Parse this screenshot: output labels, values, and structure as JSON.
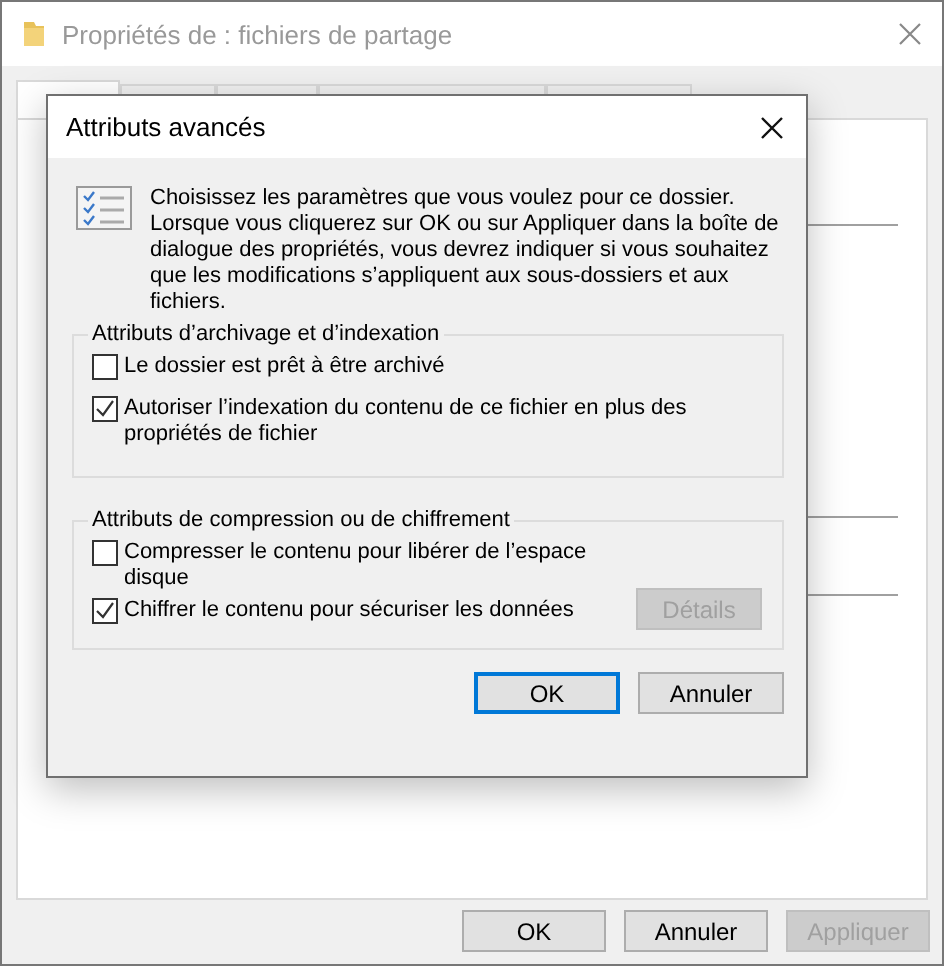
{
  "window": {
    "title": "Propriétés de : fichiers de partage"
  },
  "tabs": [
    {
      "selected": true
    },
    {
      "selected": false
    },
    {
      "selected": false
    },
    {
      "selected": false
    },
    {
      "selected": false
    }
  ],
  "dialog": {
    "title": "Attributs avancés",
    "description": " Choisissez les paramètres que vous voulez pour ce dossier. Lorsque vous cliquerez sur OK ou sur Appliquer dans la boîte de dialogue des propriétés, vous devrez indiquer si vous souhaitez que les modifications s’appliquent aux sous-dossiers et aux fichiers.",
    "groups": [
      {
        "title": "Attributs d’archivage et d’indexation",
        "options": [
          {
            "label": "Le dossier est prêt à être archivé",
            "checked": false
          },
          {
            "label": "Autoriser l’indexation du contenu de ce fichier en plus des propriétés de fichier",
            "checked": true
          }
        ]
      },
      {
        "title": "Attributs de compression ou de chiffrement",
        "options": [
          {
            "label": "Compresser le contenu pour libérer de l’espace disque",
            "checked": false
          },
          {
            "label": "Chiffrer le contenu pour sécuriser les données",
            "checked": true
          }
        ],
        "button": {
          "label": "Détails",
          "disabled": true
        }
      }
    ],
    "buttons": [
      {
        "label": "OK",
        "default": true
      },
      {
        "label": "Annuler",
        "default": false
      }
    ]
  },
  "footer_buttons": [
    {
      "label": "OK",
      "disabled": false
    },
    {
      "label": "Annuler",
      "disabled": false
    },
    {
      "label": "Appliquer",
      "disabled": true
    }
  ]
}
